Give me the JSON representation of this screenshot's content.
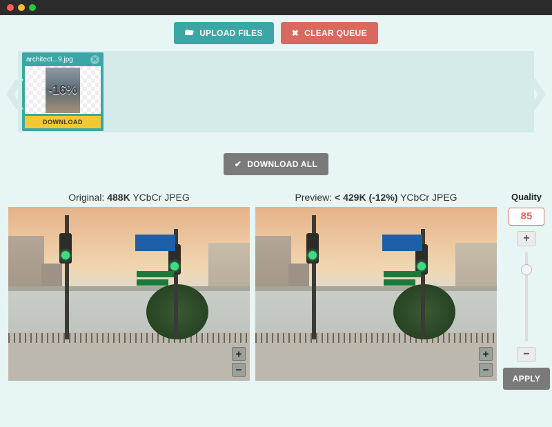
{
  "toolbar": {
    "upload_label": "UPLOAD FILES",
    "clear_label": "CLEAR QUEUE",
    "download_all_label": "DOWNLOAD ALL"
  },
  "queue": {
    "items": [
      {
        "filename": "architect...9.jpg",
        "savings_pct": "-16%",
        "download_label": "DOWNLOAD"
      }
    ]
  },
  "compare": {
    "original": {
      "prefix": "Original: ",
      "size": "488K",
      "suffix": " YCbCr JPEG"
    },
    "preview": {
      "prefix": "Preview: ",
      "size": "< 429K (-12%)",
      "suffix": " YCbCr JPEG"
    }
  },
  "quality": {
    "label": "Quality",
    "value": "85",
    "apply_label": "APPLY"
  },
  "icons": {
    "plus": "+",
    "minus": "−",
    "close": "✕",
    "check": "✔",
    "folder": "📁",
    "clear": "✖"
  }
}
